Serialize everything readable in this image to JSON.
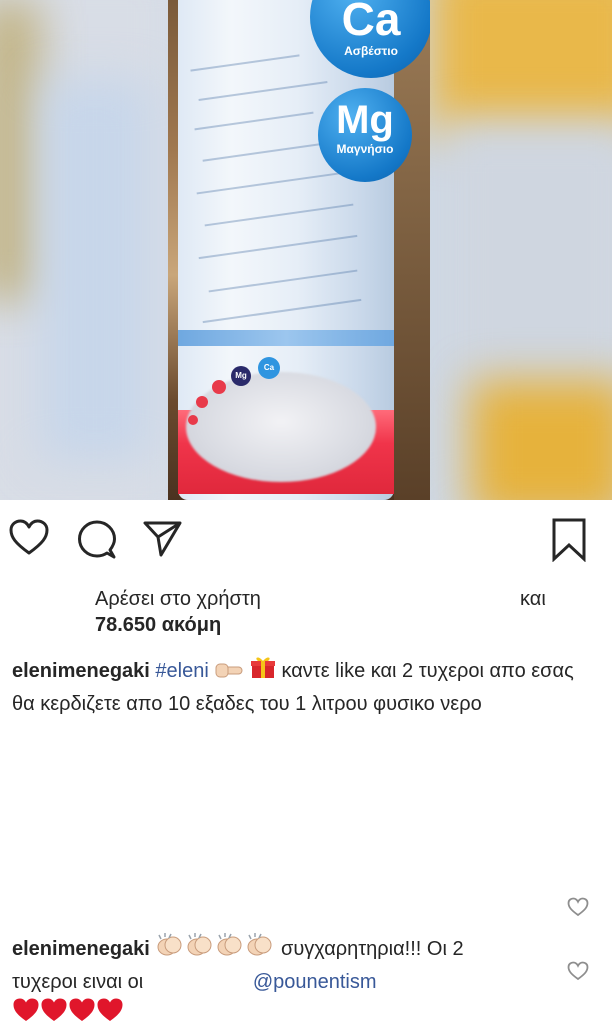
{
  "post": {
    "image": {
      "badges": [
        {
          "symbol": "Ca",
          "name": "Ασβέστιο"
        },
        {
          "symbol": "Mg",
          "name": "Μαγνήσιο"
        }
      ],
      "mini_badges": [
        "Mg",
        "Ca"
      ]
    },
    "actions": {
      "like_icon": "heart-outline-icon",
      "comment_icon": "comment-bubble-icon",
      "share_icon": "paper-plane-icon",
      "save_icon": "bookmark-icon"
    },
    "likes": {
      "prefix": "Αρέσει στο χρήστη",
      "and": "και",
      "count": "78.650 ακόμη"
    },
    "caption": {
      "username": "elenimenegaki",
      "hashtag": "#eleni",
      "emojis": [
        "pointing-hand-emoji",
        "gift-emoji"
      ],
      "text": "καντε like και 2 τυχεροι απο εσας θα κερδιζετε απο 10 εξαδες του 1 λιτρου φυσικο νερο"
    },
    "comment": {
      "username": "elenimenegaki",
      "emojis": [
        "clapping-hands-emoji",
        "clapping-hands-emoji",
        "clapping-hands-emoji",
        "clapping-hands-emoji"
      ],
      "text_1": "συγχαρητηρια!!! Οι 2",
      "text_2": "τυχεροι ειναι οι",
      "mention": "@pounentism",
      "hearts": [
        "red-heart-emoji",
        "red-heart-emoji",
        "red-heart-emoji",
        "red-heart-emoji"
      ]
    }
  },
  "colors": {
    "text": "#262626",
    "link": "#385898",
    "heart": "#e0162b",
    "badge_blue": "#1478c8",
    "label_red": "#f0344a"
  }
}
